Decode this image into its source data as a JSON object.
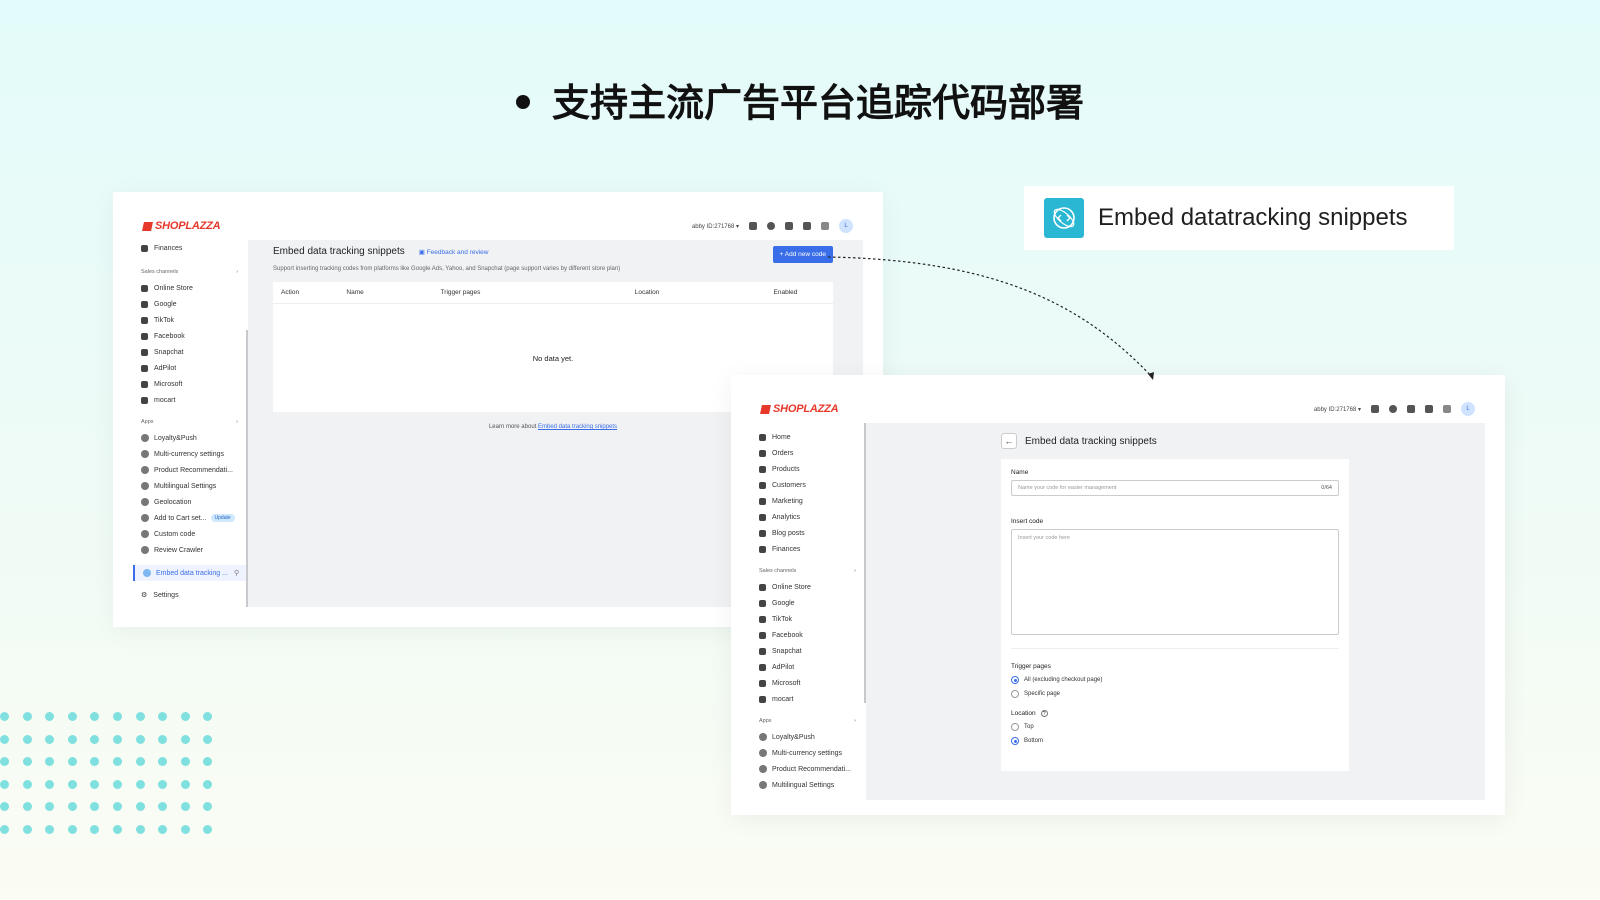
{
  "headline": "支持主流广告平台追踪代码部署",
  "badge": {
    "label": "Embed datatracking snippets",
    "icon": "embed-code-icon",
    "icon_color": "#29b7d3"
  },
  "brand": {
    "name": "SHOPLAZZA",
    "color": "#e6392b"
  },
  "account": {
    "user": "abby",
    "id": "ID:271768",
    "avatar": "L"
  },
  "accent_color": "#3a6ee8",
  "window1": {
    "sidebar": {
      "top_item": "Finances",
      "sales_channels_label": "Sales channels",
      "sales_channels": [
        "Online Store",
        "Google",
        "TikTok",
        "Facebook",
        "Snapchat",
        "AdPilot",
        "Microsoft",
        "mocart"
      ],
      "apps_label": "Apps",
      "apps": [
        "Loyalty&Push",
        "Multi-currency settings",
        "Product Recommendati...",
        "Multilingual Settings",
        "Geolocation",
        "Add to Cart set...",
        "Custom code",
        "Review Crawler"
      ],
      "update_badge": "Update",
      "active_item": "Embed data tracking ...",
      "settings": "Settings"
    },
    "title": "Embed data tracking snippets",
    "feedback": "Feedback and review",
    "description": "Support inserting tracking codes from platforms like Google Ads, Yahoo, and Snapchat (page support varies by different store plan)",
    "add_button": "+ Add new code",
    "table": {
      "columns": [
        "Action",
        "Name",
        "Trigger pages",
        "Location",
        "Enabled"
      ],
      "empty": "No data yet."
    },
    "learn_more": "Learn more about",
    "learn_link": "Embed data tracking snippets"
  },
  "window2": {
    "sidebar": {
      "main": [
        "Home",
        "Orders",
        "Products",
        "Customers",
        "Marketing",
        "Analytics",
        "Blog posts",
        "Finances"
      ],
      "sales_channels_label": "Sales channels",
      "sales_channels": [
        "Online Store",
        "Google",
        "TikTok",
        "Facebook",
        "Snapchat",
        "AdPilot",
        "Microsoft",
        "mocart"
      ],
      "apps_label": "Apps",
      "apps": [
        "Loyalty&Push",
        "Multi-currency settings",
        "Product Recommendati...",
        "Multilingual Settings"
      ]
    },
    "title": "Embed data tracking snippets",
    "form": {
      "name_label": "Name",
      "name_placeholder": "Name your code for easier management",
      "name_counter": "0/64",
      "code_label": "Insert code",
      "code_placeholder": "Insert your code here",
      "trigger_label": "Trigger pages",
      "trigger_options": [
        "All (excluding checkout page)",
        "Specific page"
      ],
      "trigger_selected": "All (excluding checkout page)",
      "location_label": "Location",
      "location_options": [
        "Top",
        "Bottom"
      ],
      "location_selected": "Bottom"
    }
  }
}
